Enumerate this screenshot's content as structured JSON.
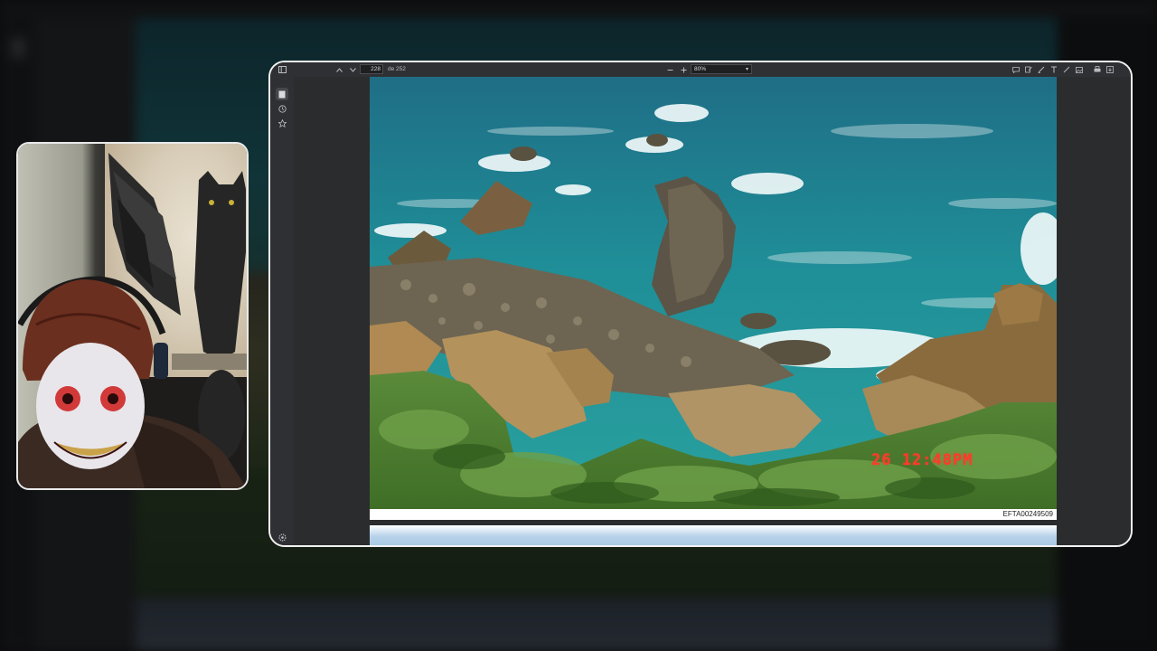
{
  "viewer": {
    "toolbar": {
      "page_current": "228",
      "page_total": "de 252",
      "zoom": "80%",
      "icons": [
        "sidebar-toggle-icon",
        "prev-page-icon",
        "next-page-icon",
        "zoom-out-icon",
        "zoom-in-icon",
        "comment-icon",
        "highlight-icon",
        "draw-icon",
        "text-icon",
        "signature-icon",
        "image-icon",
        "print-icon",
        "save-icon"
      ]
    },
    "sidebar": {
      "icons": [
        "thumbnails-icon",
        "history-icon",
        "bookmark-icon",
        "settings-icon"
      ]
    },
    "document": {
      "page_id": "EFTA00249509",
      "photo_date_stamp": "26 12:48PM"
    }
  },
  "webcam": {
    "description_icons": [
      "winged-cat-painting",
      "masked-person"
    ]
  },
  "colors": {
    "toolbar": "#2f3033",
    "page_bg": "#2b2c2e",
    "date_stamp": "#ff3b2a"
  }
}
